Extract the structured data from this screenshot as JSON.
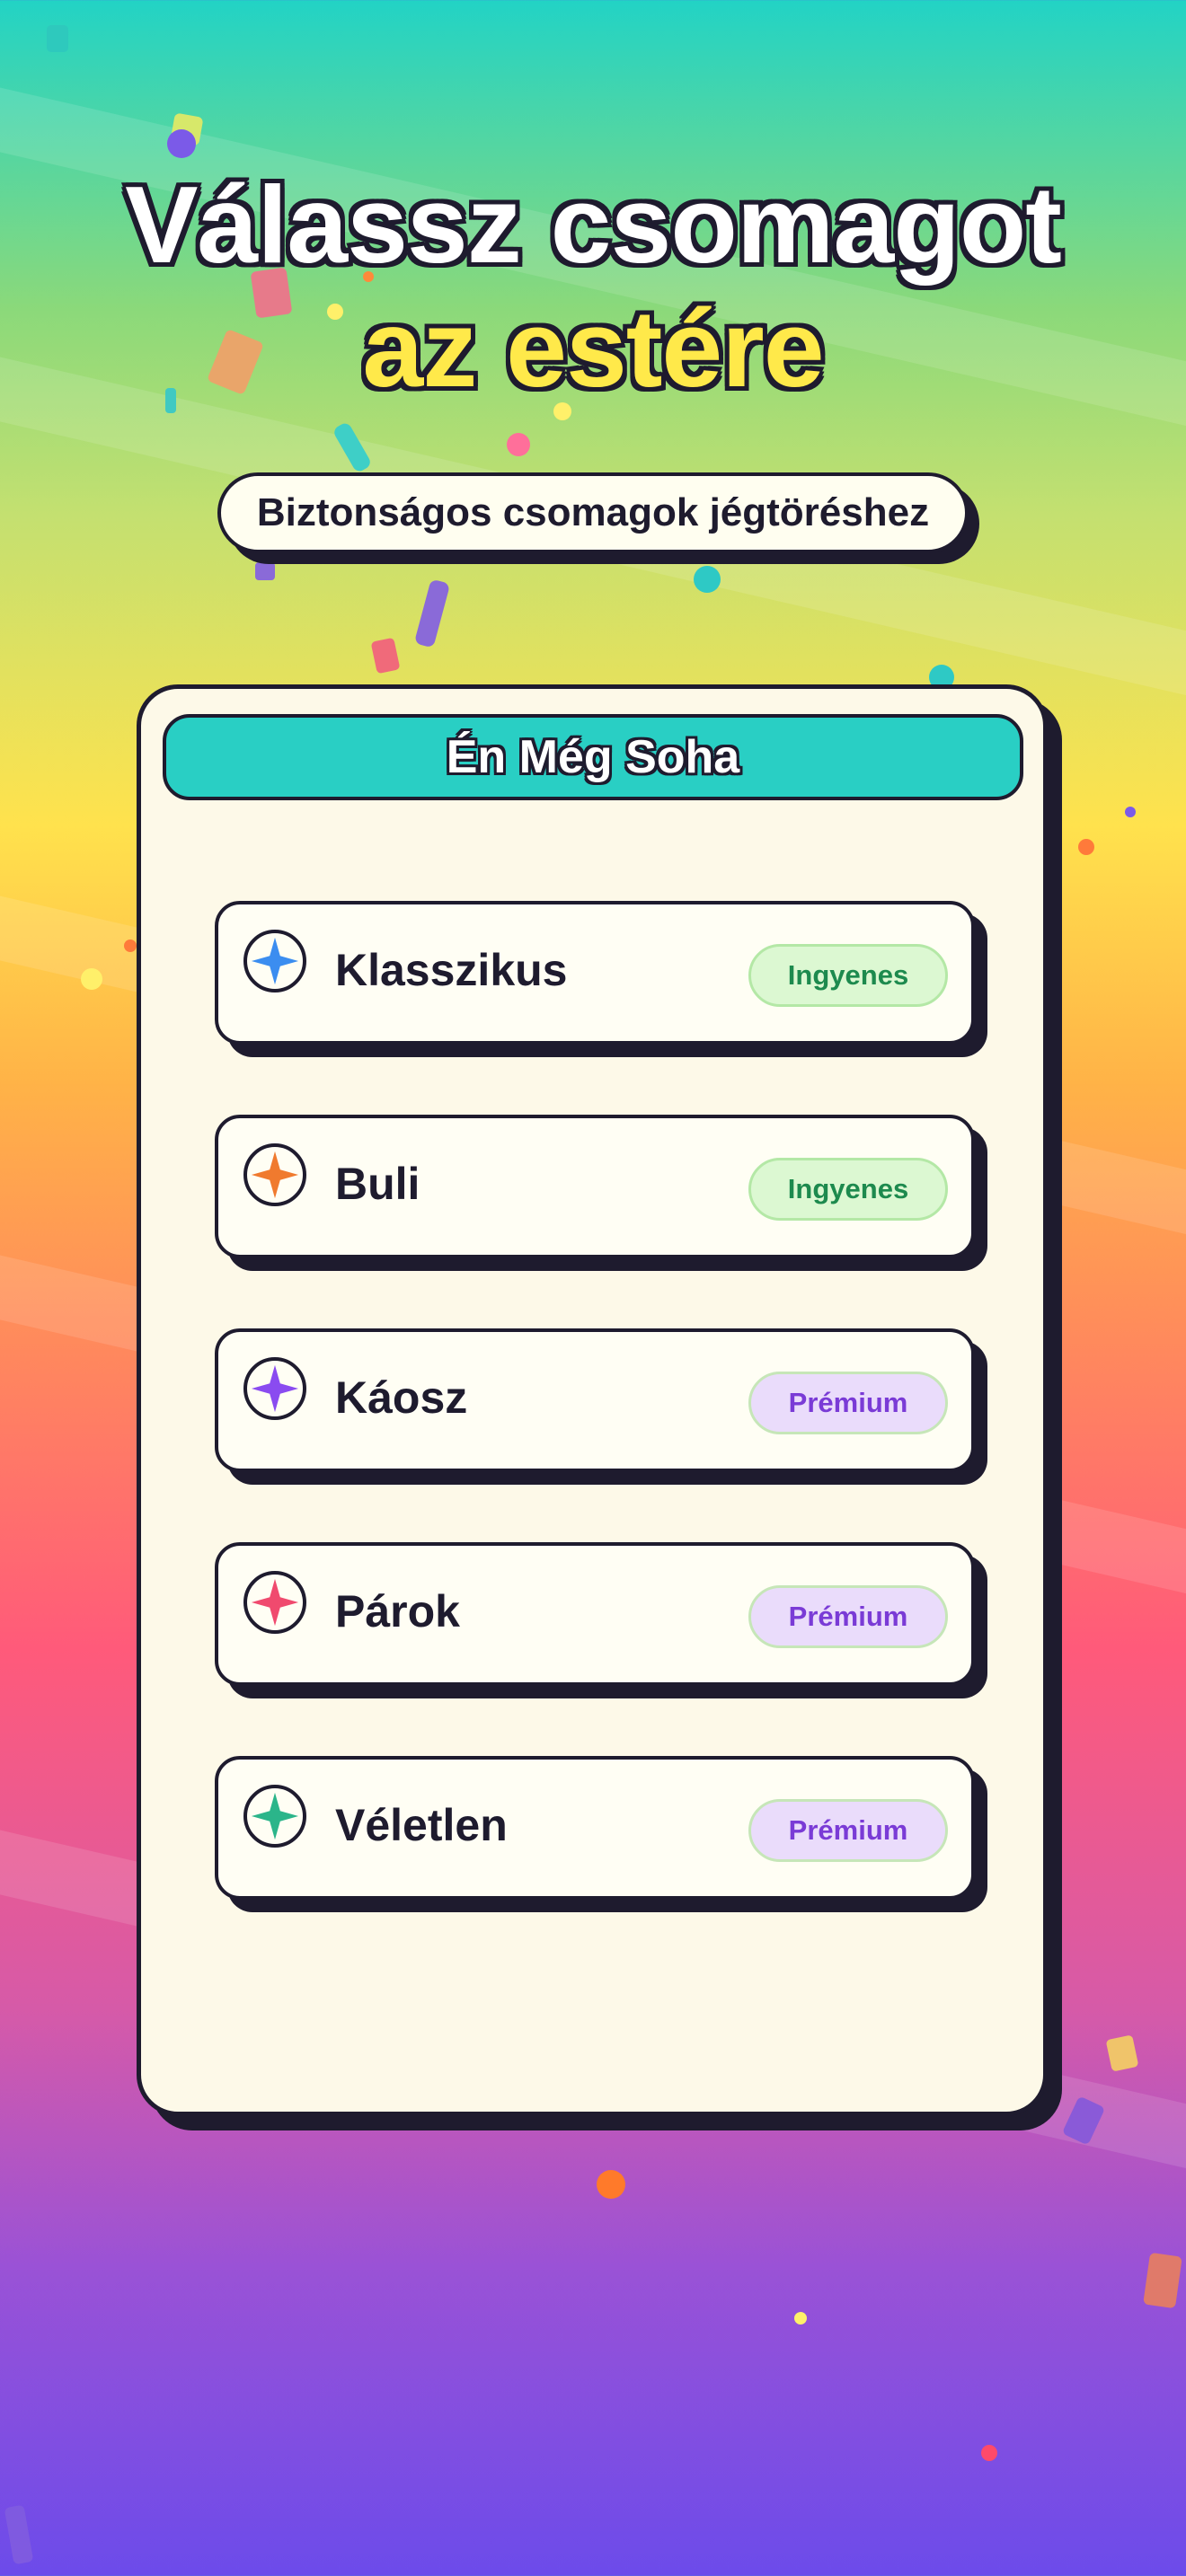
{
  "headline": {
    "line1": "Válassz csomagot",
    "line2": "az estére"
  },
  "subtitle": "Biztonságos csomagok jégtöréshez",
  "game_card": {
    "title": "Én Még Soha",
    "packs": [
      {
        "name": "Klasszikus",
        "badge": "Ingyenes",
        "tier": "free",
        "icon": "sparkle-icon",
        "icon_color": "#3b8df0"
      },
      {
        "name": "Buli",
        "badge": "Ingyenes",
        "tier": "free",
        "icon": "sparkle-icon",
        "icon_color": "#f07a2e"
      },
      {
        "name": "Káosz",
        "badge": "Prémium",
        "tier": "premium",
        "icon": "sparkle-icon",
        "icon_color": "#8a4bf0"
      },
      {
        "name": "Párok",
        "badge": "Prémium",
        "tier": "premium",
        "icon": "sparkle-icon",
        "icon_color": "#f04a6e"
      },
      {
        "name": "Véletlen",
        "badge": "Prémium",
        "tier": "premium",
        "icon": "sparkle-icon",
        "icon_color": "#2bb58a"
      }
    ]
  },
  "colors": {
    "outline": "#1e1b2e",
    "header_bg": "#29cfc4",
    "headline_accent": "#ffe94a",
    "card_bg": "#fdf9e8"
  }
}
